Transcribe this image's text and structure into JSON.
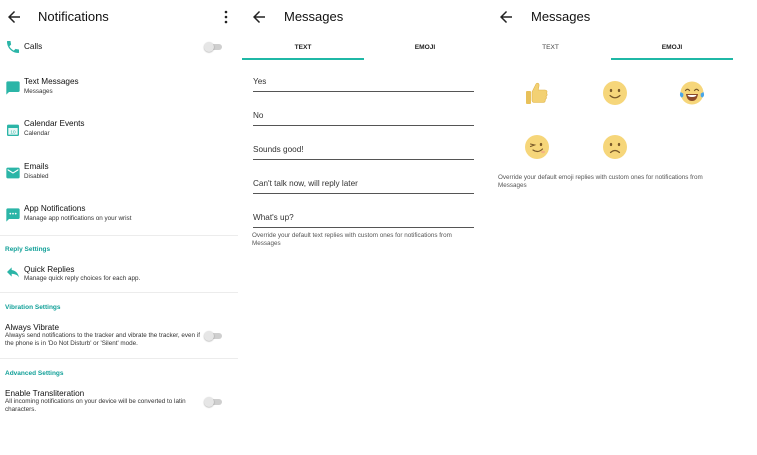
{
  "notifications": {
    "title": "Notifications",
    "items": [
      {
        "label": "Calls",
        "sub": ""
      },
      {
        "label": "Text Messages",
        "sub": "Messages"
      },
      {
        "label": "Calendar Events",
        "sub": "Calendar"
      },
      {
        "label": "Emails",
        "sub": "Disabled"
      },
      {
        "label": "App Notifications",
        "sub": "Manage app notifications on your wrist"
      }
    ],
    "reply_section": "Reply Settings",
    "quick_replies": {
      "label": "Quick Replies",
      "sub": "Manage quick reply choices for each app."
    },
    "vibration_section": "Vibration Settings",
    "always_vibrate": {
      "label": "Always Vibrate",
      "sub": "Always send notifications to the tracker and vibrate the tracker, even if the phone is in 'Do Not Disturb' or 'Silent' mode."
    },
    "advanced_section": "Advanced Settings",
    "transliteration": {
      "label": "Enable Transliteration",
      "sub": "All incoming notifications on your device will be converted to latin characters."
    }
  },
  "messages_text": {
    "title": "Messages",
    "tabs": [
      "TEXT",
      "EMOJI"
    ],
    "replies": [
      "Yes",
      "No",
      "Sounds good!",
      "Can't talk now, will reply later",
      "What's up?"
    ],
    "note": "Override your default text replies with custom ones for notifications from Messages"
  },
  "messages_emoji": {
    "title": "Messages",
    "tabs": [
      "TEXT",
      "EMOJI"
    ],
    "emojis": [
      "thumbs-up",
      "smiling-face",
      "tears-of-joy",
      "winking-face",
      "frowning-face"
    ],
    "note": "Override your default emoji replies with custom ones for notifications from Messages"
  },
  "colors": {
    "accent": "#1fb8a6",
    "section": "#11a098",
    "emoji": "#f6d67a"
  }
}
